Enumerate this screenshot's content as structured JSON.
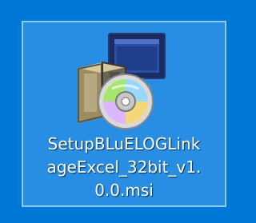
{
  "desktop": {
    "background_color": "#0078d7",
    "selected_icon": {
      "icon_name": "msi-installer-icon",
      "file_name_lines": [
        "SetupBLuELOGLink",
        "ageExcel_32bit_v1.",
        "0.0.msi"
      ]
    }
  }
}
